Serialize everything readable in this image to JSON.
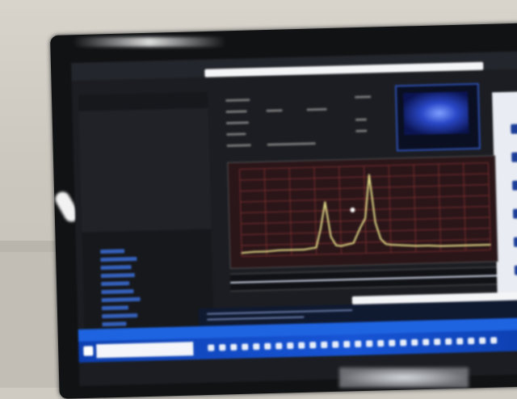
{
  "scene": {
    "description_visible_text": "",
    "colors": {
      "wall": "#cfcbc3",
      "bezel": "#111214",
      "screen_bg": "#1b1d22",
      "chart_bg": "#2a1518",
      "chart_grid": "#7a2f2f",
      "trace": "#e6e08a",
      "taskbar": "#1755d6"
    }
  },
  "chart_data": {
    "type": "line",
    "title": "",
    "xlabel": "",
    "ylabel": "",
    "x": [
      0,
      5,
      10,
      15,
      20,
      25,
      30,
      32,
      34,
      36,
      38,
      40,
      45,
      48,
      50,
      52,
      54,
      56,
      58,
      60,
      65,
      70,
      75,
      80,
      85,
      90,
      95,
      100
    ],
    "series": [
      {
        "values": [
          4,
          5,
          5,
          6,
          6,
          6,
          8,
          30,
          60,
          20,
          10,
          9,
          12,
          30,
          40,
          90,
          35,
          16,
          10,
          9,
          8,
          7,
          7,
          6,
          6,
          6,
          6,
          6
        ]
      }
    ],
    "xlim": [
      0,
      100
    ],
    "ylim": [
      0,
      100
    ],
    "grid": true
  }
}
